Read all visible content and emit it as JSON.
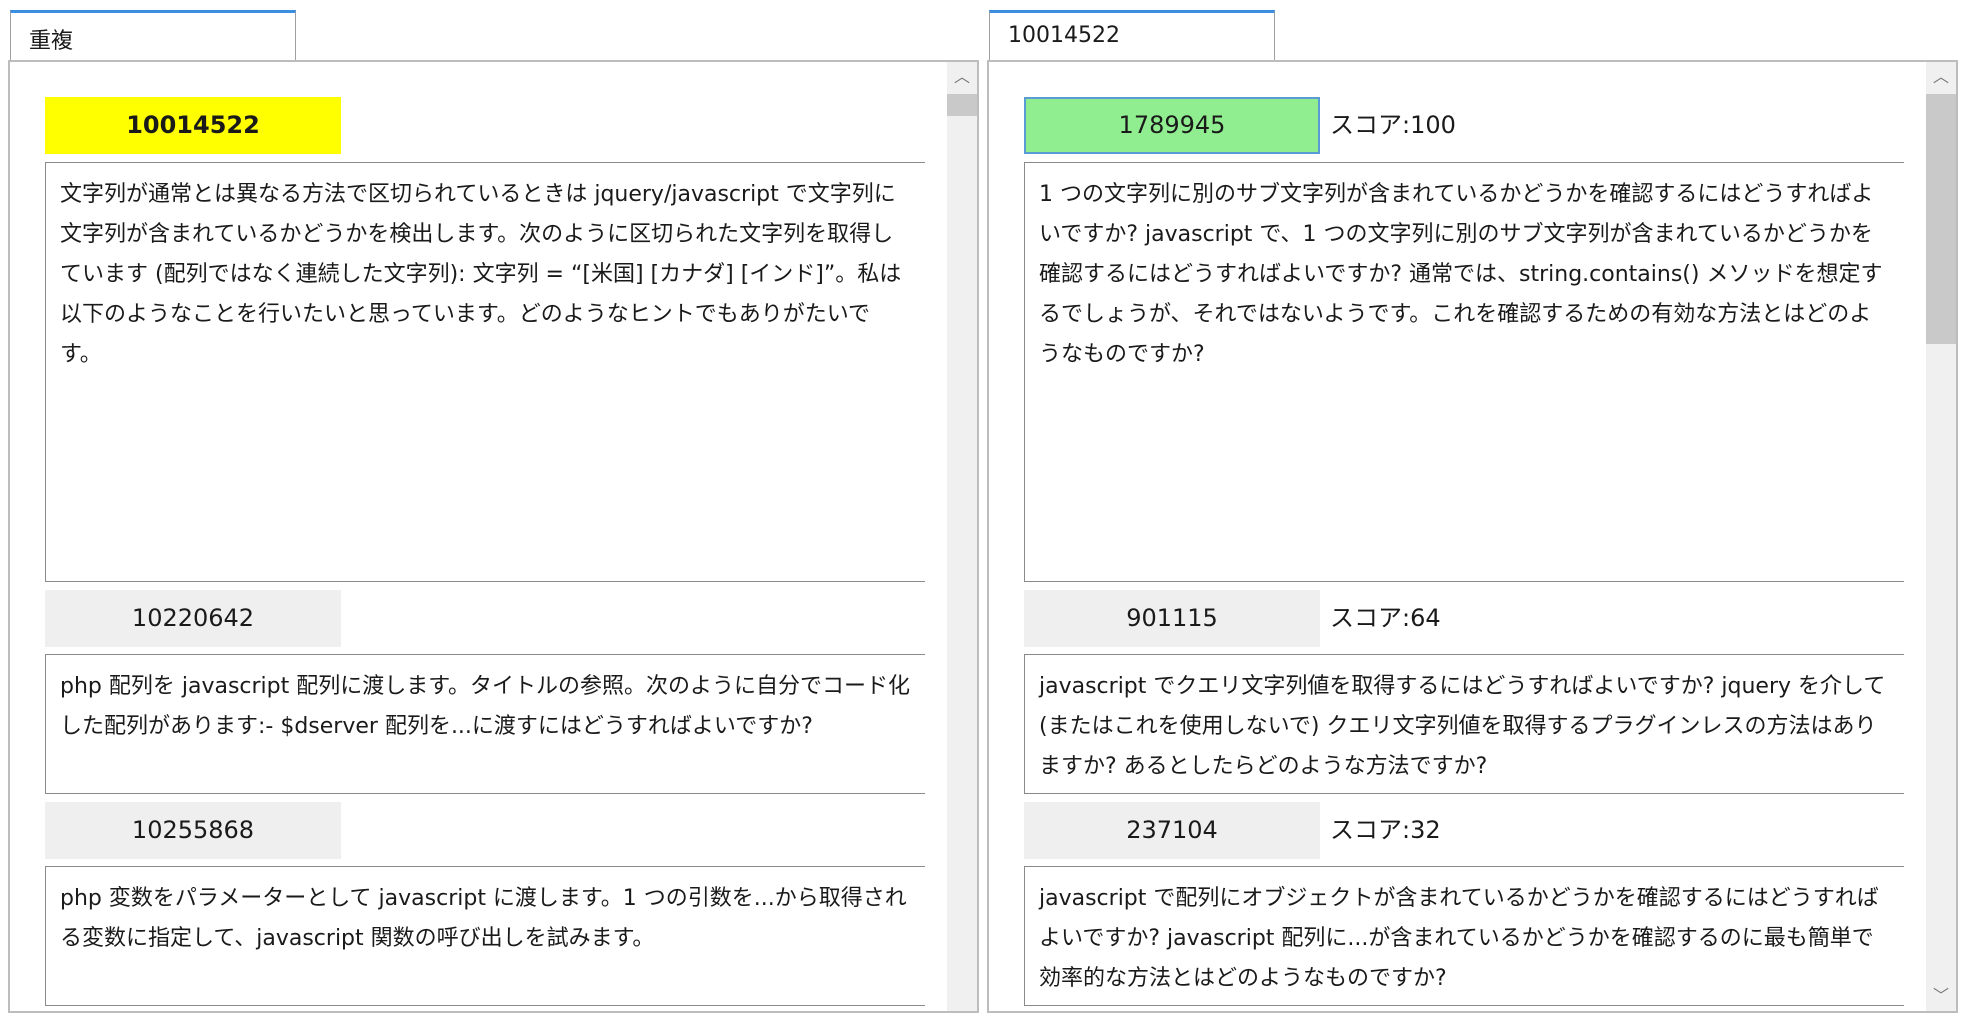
{
  "left": {
    "tab_label": "重複",
    "items": [
      {
        "id": "10014522",
        "text": "文字列が通常とは異なる方法で区切られているときは jquery/javascript で文字列に文字列が含まれているかどうかを検出します。次のように区切られた文字列を取得しています (配列ではなく連続した文字列): 文字列 = “[米国] [カナダ] [インド]”。私は以下のようなことを行いたいと思っています。どのようなヒントでもありがたいです。"
      },
      {
        "id": "10220642",
        "text": "php 配列を javascript 配列に渡します。タイトルの参照。次のように自分でコード化した配列があります:- $dserver 配列を...に渡すにはどうすればよいですか?"
      },
      {
        "id": "10255868",
        "text": "php 変数をパラメーターとして javascript に渡します。1 つの引数を...から取得される変数に指定して、javascript 関数の呼び出しを試みます。"
      }
    ]
  },
  "right": {
    "tab_label": "10014522",
    "items": [
      {
        "id": "1789945",
        "score": "スコア:100",
        "text": "1 つの文字列に別のサブ文字列が含まれているかどうかを確認するにはどうすればよいですか? javascript で、1 つの文字列に別のサブ文字列が含まれているかどうかを確認するにはどうすればよいですか? 通常では、string.contains() メソッドを想定するでしょうが、それではないようです。これを確認するための有効な方法とはどのようなものですか?"
      },
      {
        "id": "901115",
        "score": "スコア:64",
        "text": "javascript でクエリ文字列値を取得するにはどうすればよいですか? jquery を介して (またはこれを使用しないで) クエリ文字列値を取得するプラグインレスの方法はありますか? あるとしたらどのような方法ですか?"
      },
      {
        "id": "237104",
        "score": "スコア:32",
        "text": "javascript で配列にオブジェクトが含まれているかどうかを確認するにはどうすればよいですか? javascript 配列に...が含まれているかどうかを確認するのに最も簡単で効率的な方法とはどのようなものですか?"
      }
    ]
  },
  "icons": {
    "scroll_up": "chevron-up-icon",
    "scroll_down": "chevron-down-icon"
  },
  "colors": {
    "duplicate_highlight": "#ffff00",
    "selected_highlight": "#90ee90",
    "tab_accent": "#3b8ee0"
  }
}
